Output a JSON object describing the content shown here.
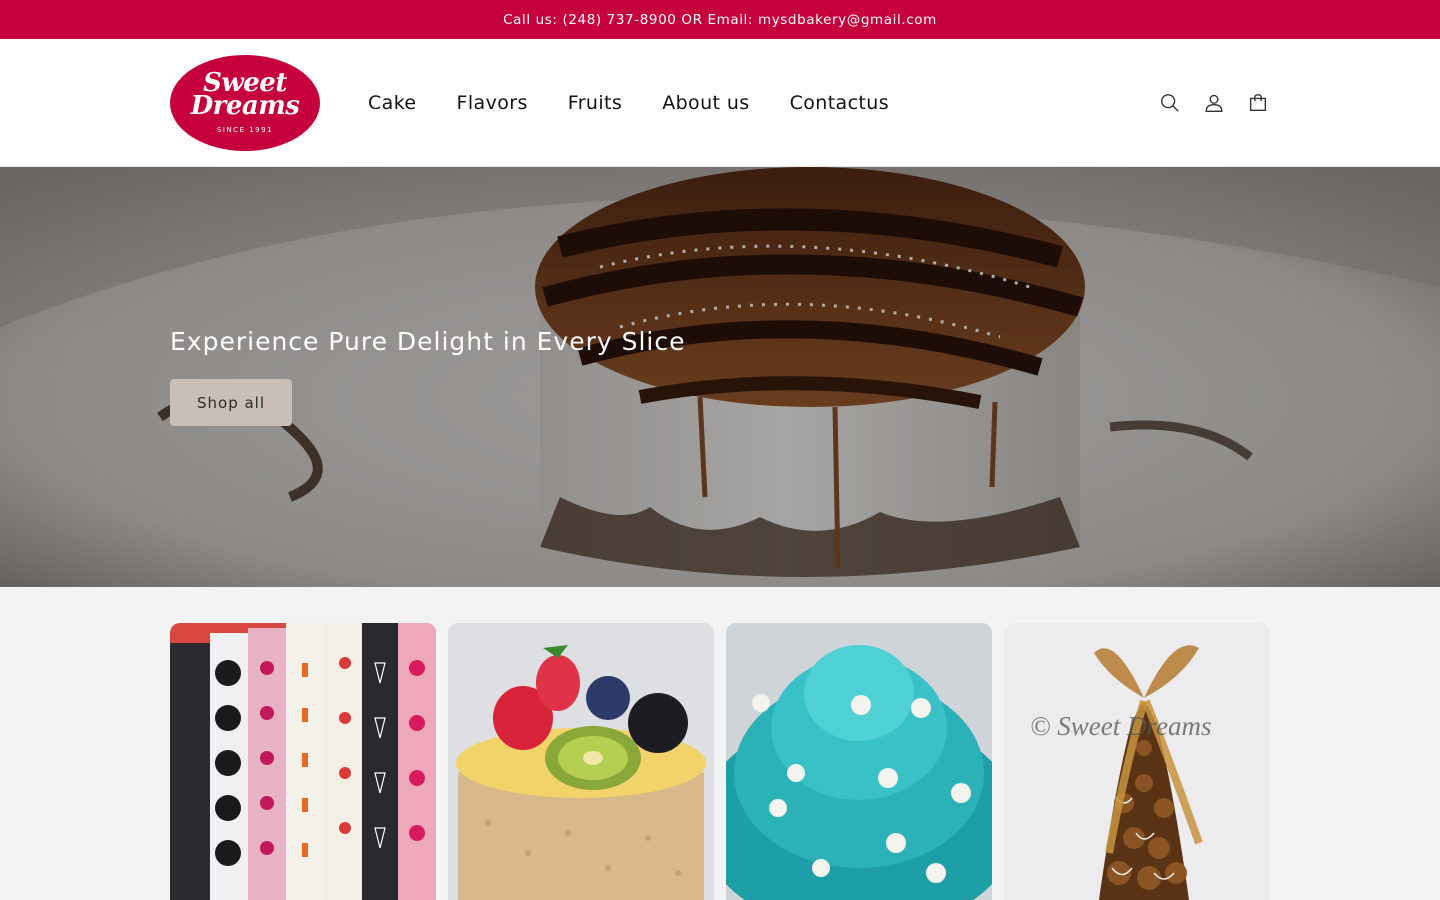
{
  "announcement": {
    "text": "Call us: (248) 737-8900 OR Email: mysdbakery@gmail.com"
  },
  "brand": {
    "line1": "Sweet",
    "line2": "Dreams",
    "line3": "SINCE 1991",
    "color": "#c5003d"
  },
  "nav": {
    "items": [
      {
        "label": "Cake"
      },
      {
        "label": "Flavors"
      },
      {
        "label": "Fruits"
      },
      {
        "label": "About us"
      },
      {
        "label": "Contactus"
      }
    ]
  },
  "header_icons": [
    "search-icon",
    "account-icon",
    "cart-icon"
  ],
  "hero": {
    "title": "Experience Pure Delight in Every Slice",
    "button_label": "Shop all"
  },
  "products": [
    {
      "image": "assorted-petit-fours"
    },
    {
      "image": "fruit-topped-cake"
    },
    {
      "image": "teal-frosted-cupcake"
    },
    {
      "image": "chocolate-tower-with-ribbon",
      "watermark": "© Sweet Dreams"
    }
  ]
}
